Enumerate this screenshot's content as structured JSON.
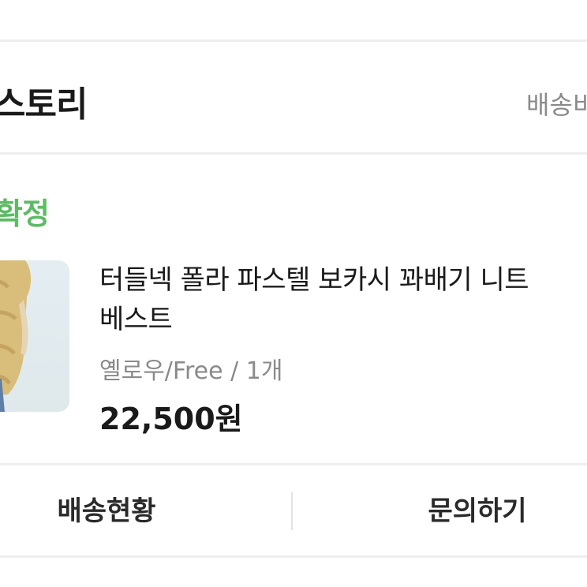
{
  "section": {
    "title": "스토리",
    "right_link": "배송비"
  },
  "order": {
    "status": "확정",
    "status_color": "#5dbb63",
    "product_name_line1": "터들넥 폴라 파스텔 보카시 꽈배기 니트",
    "product_name_line2": "베스트",
    "option": "옐로우/Free / 1개",
    "price": "22,500원"
  },
  "actions": {
    "shipping_status": "배송현황",
    "inquiry": "문의하기"
  }
}
